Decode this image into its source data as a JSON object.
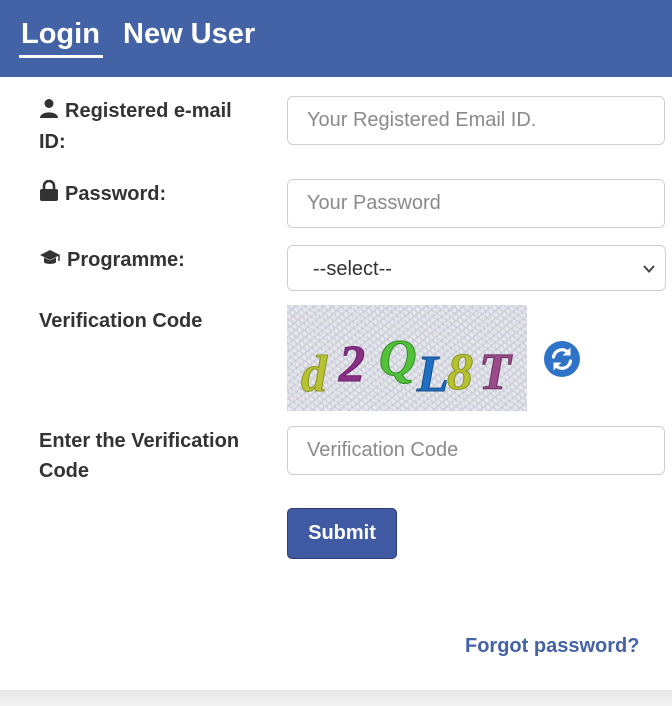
{
  "tabs": {
    "login": "Login",
    "new_user": "New User"
  },
  "form": {
    "email_label": "Registered e-mail ID:",
    "email_placeholder": "Your Registered Email ID.",
    "password_label": "Password:",
    "password_placeholder": "Your Password",
    "programme_label": "Programme:",
    "programme_selected": "--select--",
    "verification_label": "Verification Code",
    "enter_verification_label": "Enter the Verification Code",
    "verification_placeholder": "Verification Code",
    "submit_label": "Submit"
  },
  "captcha": {
    "text": "d2QL8T"
  },
  "links": {
    "forgot_password": "Forgot password?"
  },
  "colors": {
    "header": "#4462a6",
    "submit": "#3f5aa3",
    "link": "#4462a6",
    "refresh": "#2e73c8"
  },
  "icons": {
    "email": "user-icon",
    "password": "lock-icon",
    "programme": "graduation-cap-icon",
    "refresh": "refresh-icon"
  }
}
